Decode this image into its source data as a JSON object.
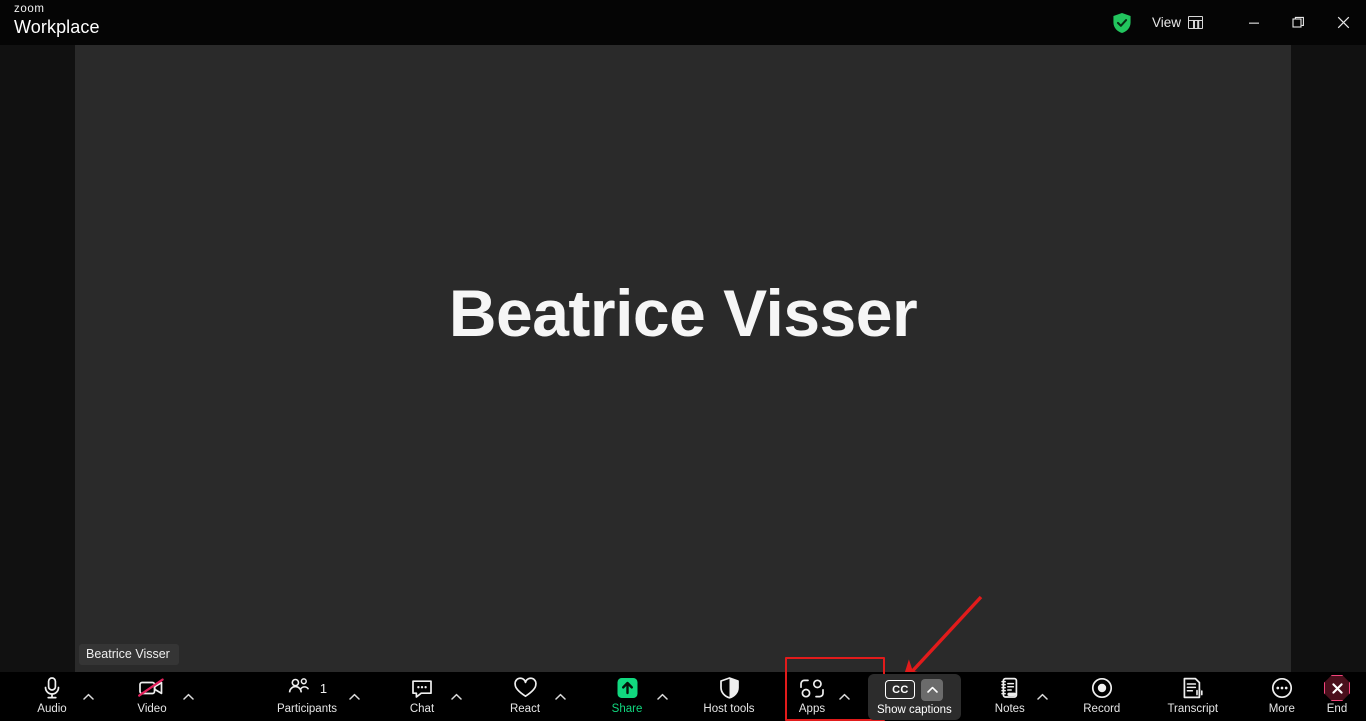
{
  "app": {
    "brand_line1": "zoom",
    "brand_line2": "Workplace"
  },
  "titlebar": {
    "security_icon": "shield-check-icon",
    "view_label": "View",
    "view_icon": "grid-layout-icon",
    "minimize_icon": "minimize-icon",
    "maximize_icon": "restore-window-icon",
    "close_icon": "close-icon"
  },
  "stage": {
    "participant_display_name": "Beatrice Visser",
    "name_badge": "Beatrice Visser",
    "background_color": "#2a2a2a"
  },
  "annotations": {
    "arrow_color": "#e21b1b",
    "highlight_color": "#e21b1b",
    "highlight_target": "Show captions"
  },
  "toolbar": {
    "items": [
      {
        "id": "audio",
        "label": "Audio",
        "icon": "microphone-icon",
        "caret": true,
        "count": null
      },
      {
        "id": "video",
        "label": "Video",
        "icon": "camera-off-icon",
        "caret": true,
        "count": null
      },
      {
        "id": "participants",
        "label": "Participants",
        "icon": "participants-icon",
        "caret": true,
        "count": "1"
      },
      {
        "id": "chat",
        "label": "Chat",
        "icon": "chat-bubble-icon",
        "caret": true,
        "count": null
      },
      {
        "id": "react",
        "label": "React",
        "icon": "heart-icon",
        "caret": true,
        "count": null
      },
      {
        "id": "share",
        "label": "Share",
        "icon": "share-screen-icon",
        "caret": true,
        "count": null
      },
      {
        "id": "host-tools",
        "label": "Host tools",
        "icon": "shield-icon",
        "caret": false,
        "count": null
      },
      {
        "id": "apps",
        "label": "Apps",
        "icon": "apps-icon",
        "caret": true,
        "count": null
      },
      {
        "id": "captions",
        "label": "Show captions",
        "icon": "cc-icon",
        "caret": true,
        "count": null
      },
      {
        "id": "notes",
        "label": "Notes",
        "icon": "notes-icon",
        "caret": true,
        "count": null
      },
      {
        "id": "record",
        "label": "Record",
        "icon": "record-icon",
        "caret": false,
        "count": null
      },
      {
        "id": "transcript",
        "label": "Transcript",
        "icon": "transcript-icon",
        "caret": false,
        "count": null
      },
      {
        "id": "more",
        "label": "More",
        "icon": "more-dots-icon",
        "caret": false,
        "count": null
      },
      {
        "id": "end",
        "label": "End",
        "icon": "end-call-icon",
        "caret": false,
        "count": null
      }
    ],
    "share_accent_color": "#11d87f",
    "end_accent_color": "#f0437a",
    "captions_active": true
  }
}
